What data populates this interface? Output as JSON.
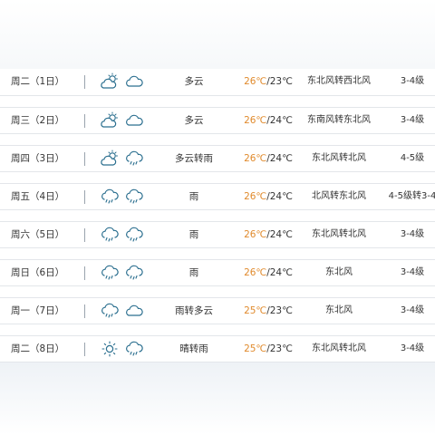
{
  "forecast": {
    "rows": [
      {
        "day": "周二（1日）",
        "icon1": "partly-cloudy-icon",
        "icon2": "cloudy-icon",
        "desc": "多云",
        "high": "26℃",
        "low": "/23℃",
        "wind": "东北风转西北风",
        "level": "3-4级"
      },
      {
        "day": "周三（2日）",
        "icon1": "partly-cloudy-icon",
        "icon2": "cloudy-icon",
        "desc": "多云",
        "high": "26℃",
        "low": "/24℃",
        "wind": "东南风转东北风",
        "level": "3-4级"
      },
      {
        "day": "周四（3日）",
        "icon1": "partly-cloudy-icon",
        "icon2": "rain-icon",
        "desc": "多云转雨",
        "high": "26℃",
        "low": "/24℃",
        "wind": "东北风转北风",
        "level": "4-5级"
      },
      {
        "day": "周五（4日）",
        "icon1": "rain-icon",
        "icon2": "rain-icon",
        "desc": "雨",
        "high": "26℃",
        "low": "/24℃",
        "wind": "北风转东北风",
        "level": "4-5级转3-4"
      },
      {
        "day": "周六（5日）",
        "icon1": "rain-icon",
        "icon2": "rain-icon",
        "desc": "雨",
        "high": "26℃",
        "low": "/24℃",
        "wind": "东北风转北风",
        "level": "3-4级"
      },
      {
        "day": "周日（6日）",
        "icon1": "rain-icon",
        "icon2": "rain-icon",
        "desc": "雨",
        "high": "26℃",
        "low": "/24℃",
        "wind": "东北风",
        "level": "3-4级"
      },
      {
        "day": "周一（7日）",
        "icon1": "rain-icon",
        "icon2": "cloudy-icon",
        "desc": "雨转多云",
        "high": "25℃",
        "low": "/23℃",
        "wind": "东北风",
        "level": "3-4级"
      },
      {
        "day": "周二（8日）",
        "icon1": "sunny-icon",
        "icon2": "rain-icon",
        "desc": "晴转雨",
        "high": "25℃",
        "low": "/23℃",
        "wind": "东北风转北风",
        "level": "3-4级"
      }
    ]
  },
  "colors": {
    "high_temp": "#e08a2c",
    "text": "#333333",
    "border": "#e3e6ea",
    "icon_stroke": "#2b6f8f"
  }
}
